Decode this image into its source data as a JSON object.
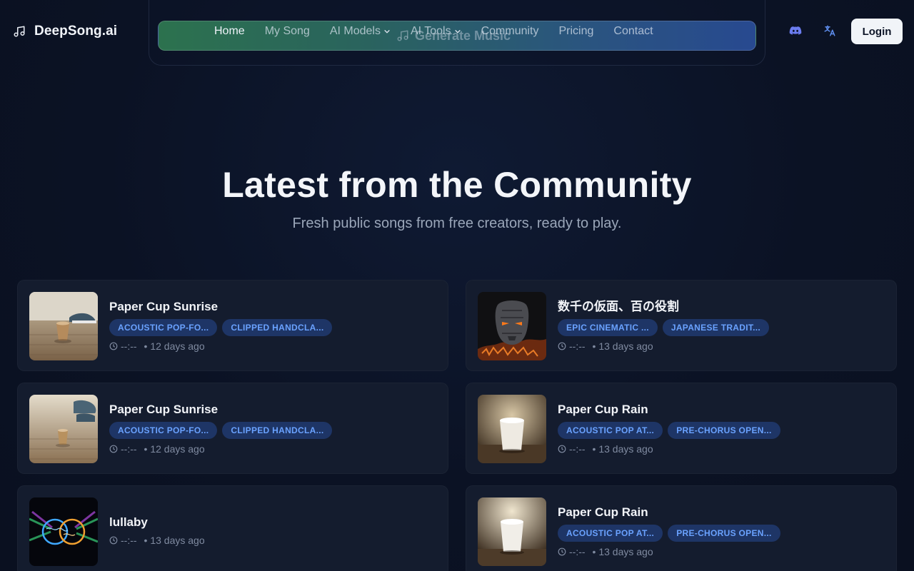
{
  "header": {
    "brand": "DeepSong.ai",
    "ghost_generate": "Generate Music",
    "nav": [
      {
        "label": "Home",
        "dropdown": false
      },
      {
        "label": "My Song",
        "dropdown": false
      },
      {
        "label": "AI Models",
        "dropdown": true
      },
      {
        "label": "AI Tools",
        "dropdown": true
      },
      {
        "label": "Community",
        "dropdown": false
      },
      {
        "label": "Pricing",
        "dropdown": false
      },
      {
        "label": "Contact",
        "dropdown": false
      }
    ],
    "login_label": "Login",
    "icons": [
      "music-note-icon",
      "discord-icon",
      "translate-icon"
    ]
  },
  "section": {
    "title": "Latest from the Community",
    "subtitle": "Fresh public songs from free creators, ready to play."
  },
  "songs": [
    {
      "title": "Paper Cup Sunrise",
      "tags": [
        "ACOUSTIC POP-FO...",
        "CLIPPED HANDCLA..."
      ],
      "duration": "--:--",
      "age": "• 12 days ago"
    },
    {
      "title": "数千の仮面、百の役割",
      "tags": [
        "EPIC CINEMATIC ...",
        "JAPANESE TRADIT..."
      ],
      "duration": "--:--",
      "age": "• 13 days ago"
    },
    {
      "title": "Paper Cup Sunrise",
      "tags": [
        "ACOUSTIC POP-FO...",
        "CLIPPED HANDCLA..."
      ],
      "duration": "--:--",
      "age": "• 12 days ago"
    },
    {
      "title": "Paper Cup Rain",
      "tags": [
        "ACOUSTIC POP AT...",
        "PRE-CHORUS OPEN..."
      ],
      "duration": "--:--",
      "age": "• 13 days ago"
    },
    {
      "title": "lullaby",
      "tags": [],
      "duration": "--:--",
      "age": "• 13 days ago"
    },
    {
      "title": "Paper Cup Rain",
      "tags": [
        "ACOUSTIC POP AT...",
        "PRE-CHORUS OPEN..."
      ],
      "duration": "--:--",
      "age": "• 13 days ago"
    }
  ],
  "colors": {
    "background": "#0b1224",
    "card": "#141c2e",
    "tag_bg": "#1e3566",
    "tag_text": "#6aa2ff",
    "accent_pink": "#ec4899"
  }
}
